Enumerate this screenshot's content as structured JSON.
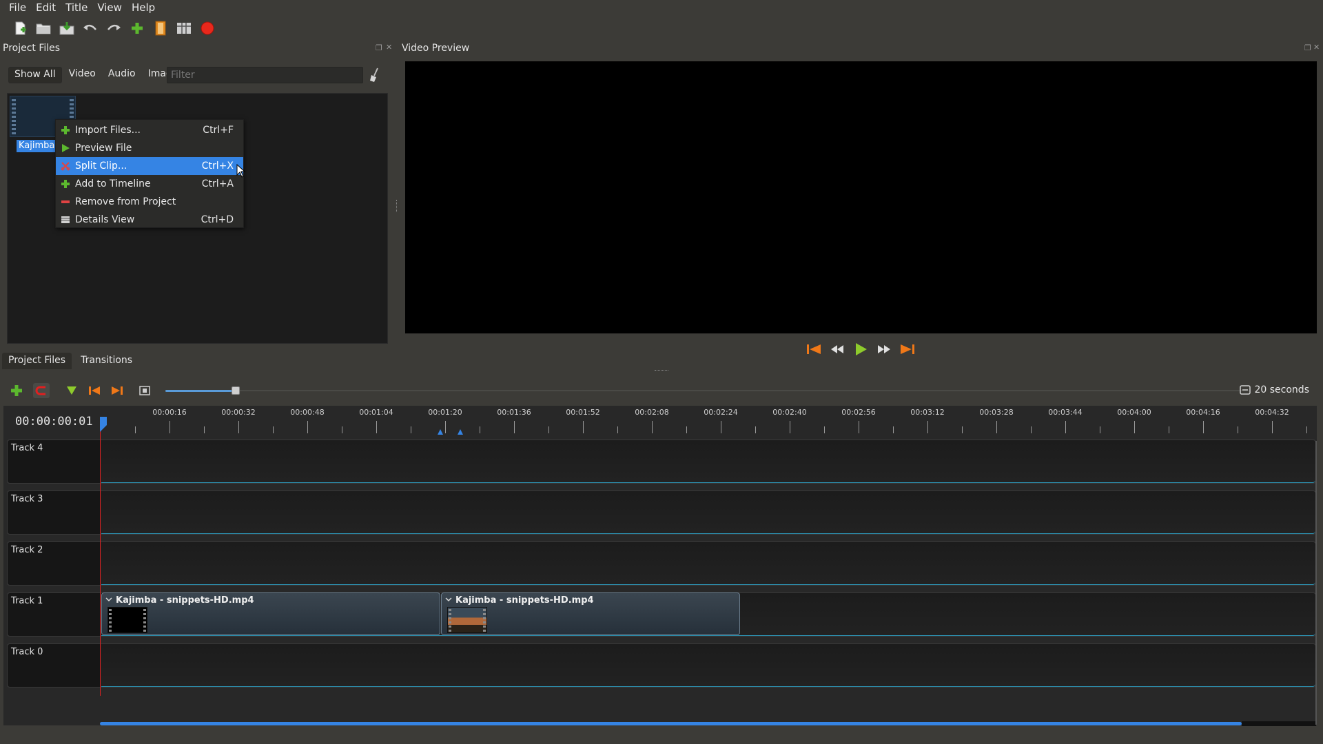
{
  "menubar": {
    "items": [
      "File",
      "Edit",
      "Title",
      "View",
      "Help"
    ]
  },
  "toolbar": {
    "buttons": [
      "new-project",
      "open-project",
      "save-project",
      "undo",
      "redo",
      "import-files",
      "choose-profile",
      "fullscreen",
      "export-video"
    ]
  },
  "project_files": {
    "title": "Project Files",
    "filter_tabs": [
      "Show All",
      "Video",
      "Audio",
      "Image"
    ],
    "filter_placeholder": "Filter",
    "file_label": "Kajimba"
  },
  "context_menu": {
    "items": [
      {
        "label": "Import Files...",
        "shortcut": "Ctrl+F",
        "icon": "plus-icon"
      },
      {
        "label": "Preview File",
        "shortcut": "",
        "icon": "play-icon"
      },
      {
        "label": "Split Clip...",
        "shortcut": "Ctrl+X",
        "icon": "scissors-icon",
        "highlighted": true
      },
      {
        "label": "Add to Timeline",
        "shortcut": "Ctrl+A",
        "icon": "plus-icon"
      },
      {
        "label": "Remove from Project",
        "shortcut": "",
        "icon": "minus-icon"
      },
      {
        "label": "Details View",
        "shortcut": "Ctrl+D",
        "icon": "details-icon"
      }
    ]
  },
  "bottom_tabs": [
    "Project Files",
    "Transitions"
  ],
  "video_preview": {
    "title": "Video Preview"
  },
  "transport": [
    "jump-start",
    "rewind",
    "play",
    "fast-forward",
    "jump-end"
  ],
  "timeline": {
    "zoom_label": "20 seconds",
    "timecode": "00:00:00:01",
    "ruler_labels": [
      "00:00:16",
      "00:00:32",
      "00:00:48",
      "00:01:04",
      "00:01:20",
      "00:01:36",
      "00:01:52",
      "00:02:08",
      "00:02:24",
      "00:02:40",
      "00:02:56",
      "00:03:12",
      "00:03:28",
      "00:03:44",
      "00:04:00",
      "00:04:16",
      "00:04:32"
    ],
    "tracks": [
      "Track 4",
      "Track 3",
      "Track 2",
      "Track 1",
      "Track 0"
    ],
    "clips": [
      {
        "name": "Kajimba - snippets-HD.mp4",
        "track": "Track 1"
      },
      {
        "name": "Kajimba - snippets-HD.mp4",
        "track": "Track 1"
      }
    ]
  },
  "colors": {
    "accent": "#3584e4",
    "playhead": "#dd2222",
    "background": "#3c3b37"
  }
}
